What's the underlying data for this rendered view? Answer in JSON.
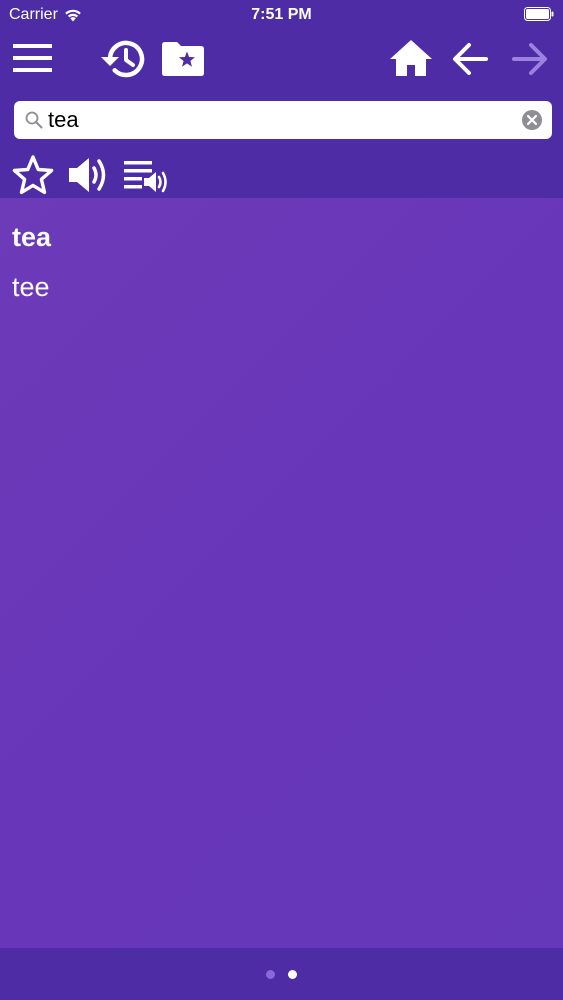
{
  "status_bar": {
    "carrier": "Carrier",
    "time": "7:51 PM"
  },
  "toolbar": {
    "icons": {
      "menu": "menu-icon",
      "history": "history-icon",
      "favorites_folder": "favorites-folder-icon",
      "home": "home-icon",
      "back": "arrow-left-icon",
      "forward": "arrow-right-icon",
      "favorite": "star-outline-icon",
      "speak": "speaker-icon",
      "speak_list": "playlist-speaker-icon"
    },
    "forward_disabled": true
  },
  "search": {
    "value": "tea",
    "placeholder": ""
  },
  "results": [
    {
      "word": "tea",
      "bold": true
    },
    {
      "word": "tee",
      "bold": false
    }
  ],
  "pager": {
    "pages": 2,
    "current": 2
  },
  "colors": {
    "bar": "#4e2ca5",
    "content": "#6737b9",
    "icon": "#ffffff",
    "icon_disabled": "#9c82e0"
  }
}
